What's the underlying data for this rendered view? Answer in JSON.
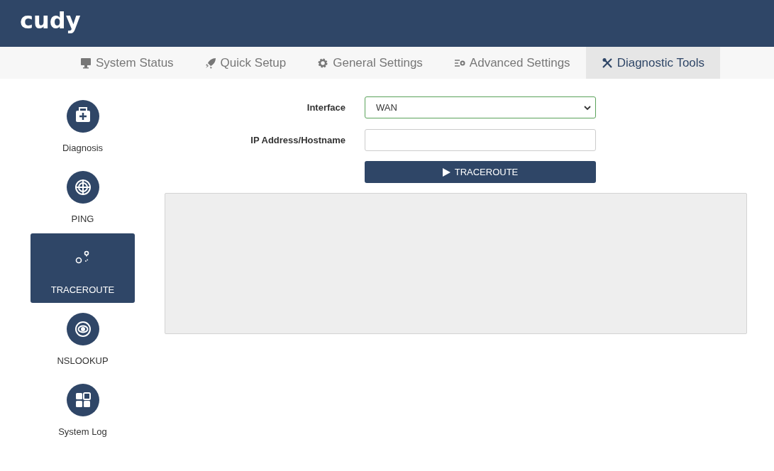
{
  "header": {
    "logo": "cudy"
  },
  "tabs": [
    {
      "label": "System Status",
      "kind": "monitor",
      "selected": false
    },
    {
      "label": "Quick Setup",
      "kind": "rocket",
      "selected": false
    },
    {
      "label": "General Settings",
      "kind": "gear",
      "selected": false
    },
    {
      "label": "Advanced Settings",
      "kind": "list",
      "selected": false
    },
    {
      "label": "Diagnostic Tools",
      "kind": "tools",
      "selected": true
    }
  ],
  "sidebar": {
    "items": [
      {
        "label": "Diagnosis",
        "kind": "kit",
        "selected": false
      },
      {
        "label": "PING",
        "kind": "target",
        "selected": false
      },
      {
        "label": "TRACEROUTE",
        "kind": "route",
        "selected": true
      },
      {
        "label": "NSLOOKUP",
        "kind": "eye",
        "selected": false
      },
      {
        "label": "System Log",
        "kind": "grid",
        "selected": false
      }
    ]
  },
  "form": {
    "fields": [
      {
        "kind": "select",
        "label": "Interface",
        "value": "WAN"
      },
      {
        "kind": "text",
        "label": "IP Address/Hostname"
      }
    ],
    "button": "TRACEROUTE"
  }
}
